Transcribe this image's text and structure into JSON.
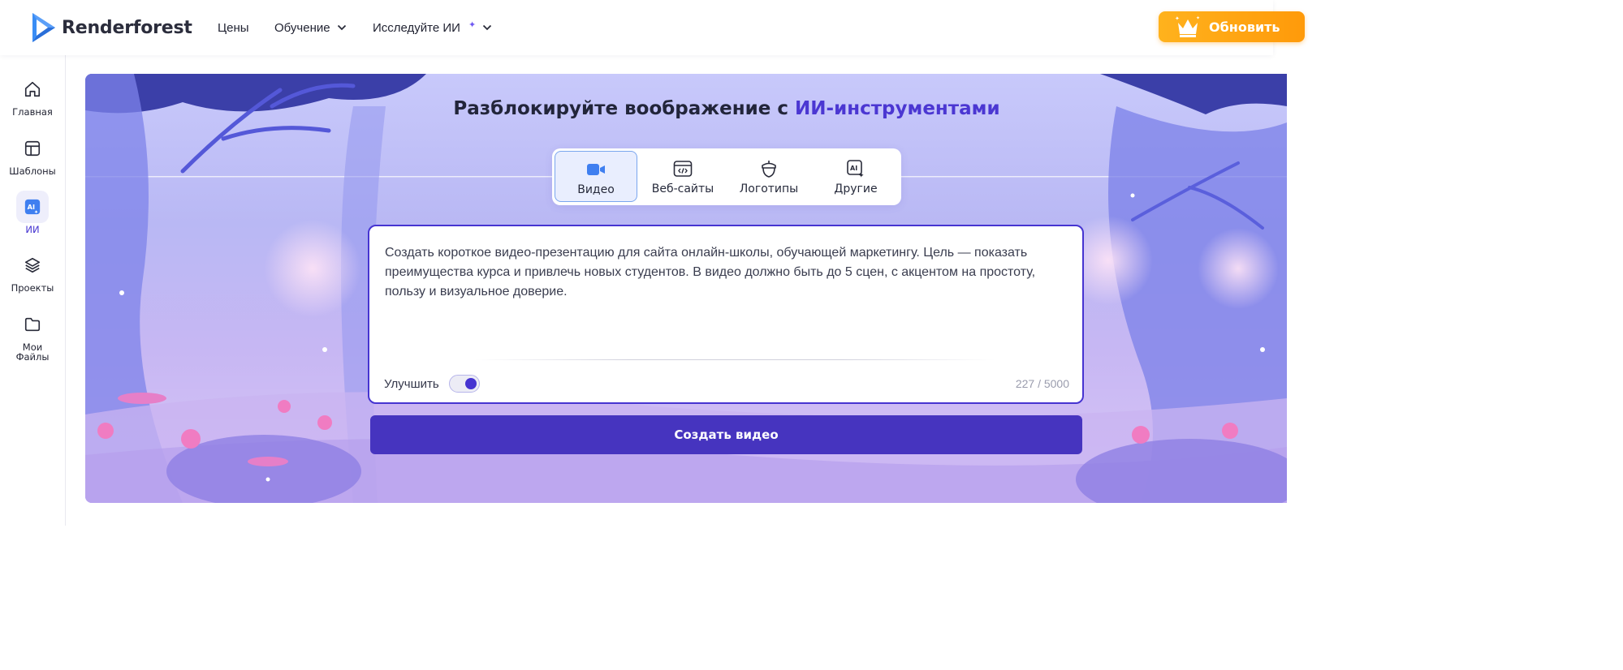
{
  "header": {
    "logo_text": "Renderforest",
    "nav": [
      {
        "label": "Цены",
        "has_dropdown": false
      },
      {
        "label": "Обучение",
        "has_dropdown": true
      },
      {
        "label": "Исследуйте ИИ",
        "has_dropdown": true
      }
    ],
    "upgrade_label": "Обновить",
    "brand_color": "#4634d1",
    "upgrade_color": "#ffa412"
  },
  "sidebar": {
    "items": [
      {
        "label": "Главная",
        "icon": "home-icon",
        "active": false
      },
      {
        "label": "Шаблоны",
        "icon": "templates-icon",
        "active": false
      },
      {
        "label": "ИИ",
        "icon": "ai-icon",
        "active": true
      },
      {
        "label": "Проекты",
        "icon": "layers-icon",
        "active": false
      },
      {
        "label": "Мои Файлы",
        "icon": "folder-icon",
        "active": false
      }
    ]
  },
  "hero": {
    "title_prefix": "Разблокируйте воображение с ",
    "title_accent": "ИИ-инструментами",
    "tabs": [
      {
        "label": "Видео",
        "icon": "video-camera-icon",
        "active": true
      },
      {
        "label": "Веб-сайты",
        "icon": "website-code-icon",
        "active": false
      },
      {
        "label": "Логотипы",
        "icon": "logo-acorn-icon",
        "active": false
      },
      {
        "label": "Другие",
        "icon": "ai-sparkle-icon",
        "active": false
      }
    ],
    "prompt": {
      "value": "Создать короткое видео-презентацию для сайта онлайн-школы, обучающей маркетингу. Цель — показать преимущества курса и привлечь новых студентов. В видео должно быть до 5 сцен, с акцентом на простоту, пользу и визуальное доверие.",
      "enhance_label": "Улучшить",
      "enhance_on": true,
      "counter": "227 / 5000"
    },
    "create_button": "Создать видео"
  }
}
